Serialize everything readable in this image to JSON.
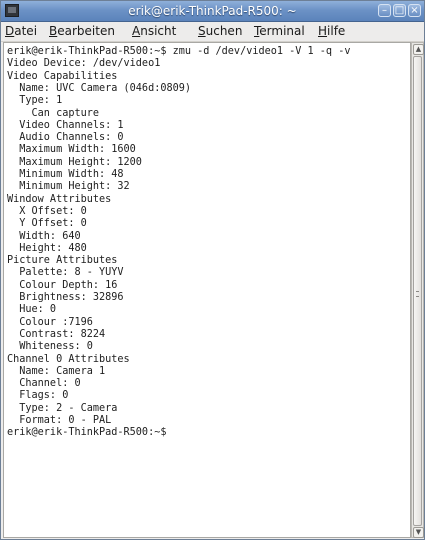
{
  "window": {
    "title": "erik@erik-ThinkPad-R500: ~",
    "icon": "terminal-icon",
    "controls": [
      "minimize-icon",
      "maximize-icon",
      "close-icon"
    ]
  },
  "menubar": {
    "items": [
      {
        "underline": "D",
        "rest": "atei"
      },
      {
        "underline": "B",
        "rest": "earbeiten"
      },
      {
        "underline": "A",
        "rest": "nsicht"
      },
      {
        "underline": "S",
        "rest": "uchen"
      },
      {
        "underline": "T",
        "rest": "erminal"
      },
      {
        "underline": "H",
        "rest": "ilfe"
      }
    ]
  },
  "terminal": {
    "lines": [
      "erik@erik-ThinkPad-R500:~$ zmu -d /dev/video1 -V 1 -q -v",
      "Video Device: /dev/video1",
      "Video Capabilities",
      "  Name: UVC Camera (046d:0809)",
      "  Type: 1",
      "    Can capture",
      "  Video Channels: 1",
      "  Audio Channels: 0",
      "  Maximum Width: 1600",
      "  Maximum Height: 1200",
      "  Minimum Width: 48",
      "  Minimum Height: 32",
      "Window Attributes",
      "  X Offset: 0",
      "  Y Offset: 0",
      "  Width: 640",
      "  Height: 480",
      "Picture Attributes",
      "  Palette: 8 - YUYV",
      "  Colour Depth: 16",
      "  Brightness: 32896",
      "  Hue: 0",
      "  Colour :7196",
      "  Contrast: 8224",
      "  Whiteness: 0",
      "Channel 0 Attributes",
      "  Name: Camera 1",
      "  Channel: 0",
      "  Flags: 0",
      "  Type: 2 - Camera",
      "  Format: 0 - PAL",
      "erik@erik-ThinkPad-R500:~$"
    ]
  },
  "scrollbar": {
    "up_icon": "arrow-up-icon",
    "down_icon": "arrow-down-icon"
  }
}
